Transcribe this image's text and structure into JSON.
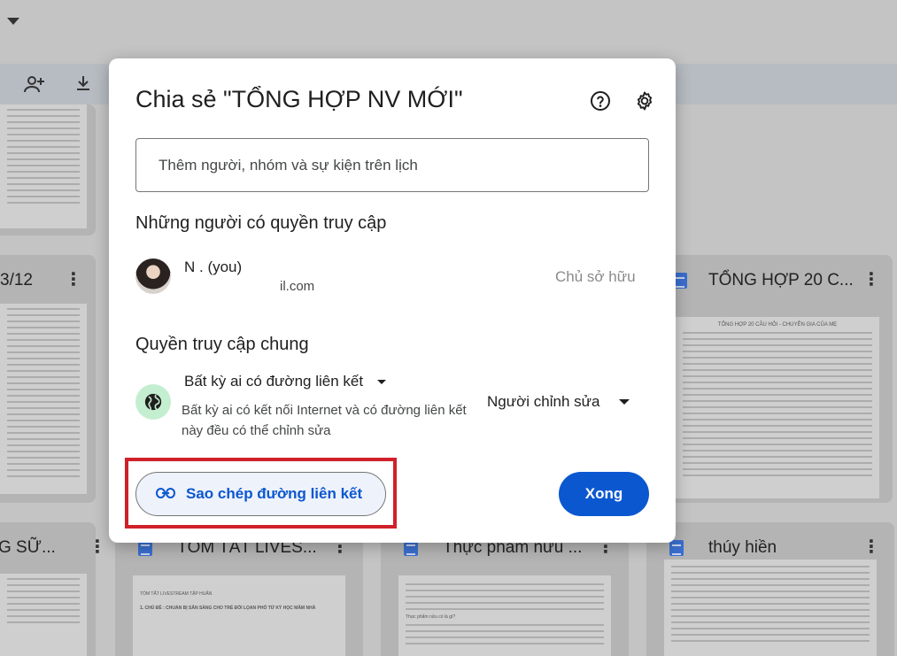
{
  "background": {
    "cards_row2": [
      {
        "title": "3/12"
      },
      {
        "title": "TỔNG HỢP 20 C..."
      }
    ],
    "cards_row3": [
      {
        "title": "G SỮ..."
      },
      {
        "title": "TÓM TẮT LIVES..."
      },
      {
        "title": "Thực phẩm nửu ..."
      },
      {
        "title": "thúy hiền"
      }
    ],
    "thumb_texts": {
      "doc_20_heading": "TỔNG HỢP 20 CÂU HỎI - CHUYÊN GIA CỦA MẸ",
      "doc_tomtat_heading": "TÓM TẮT LIVESTREAM TẬP HUẤN",
      "doc_tomtat_sub": "1. CHỦ ĐỀ : CHUẨN BỊ SẴN SÀNG CHO TRẺ ĐỐI LỌAN PHÓ TỪ KỲ HỌC MẦM NHÀ",
      "doc_thucpham_heading": "Thực phẩm nửu có là gì?"
    }
  },
  "dialog": {
    "title": "Chia sẻ \"TỔNG HỢP NV MỚI\"",
    "add_people_placeholder": "Thêm người, nhóm và sự kiện trên lịch",
    "people_section_title": "Những người có quyền truy cập",
    "user": {
      "name_visible": "N                        . (you)",
      "email_visible": "il.com",
      "role": "Chủ sở hữu"
    },
    "general_section_title": "Quyền truy cập chung",
    "general_access": {
      "option": "Bất kỳ ai có đường liên kết",
      "description": "Bất kỳ ai có kết nối Internet và có đường liên kết này đều có thể chỉnh sửa",
      "role": "Người chỉnh sửa"
    },
    "copy_link_label": "Sao chép đường liên kết",
    "done_label": "Xong"
  },
  "colors": {
    "primary": "#0b57d0",
    "highlight": "#d0202a",
    "globe_bg": "#c4eed0"
  },
  "icons": [
    "help-icon",
    "settings-icon",
    "globe-icon",
    "link-icon",
    "dropdown-caret-icon",
    "add-person-icon",
    "download-icon",
    "more-vert-icon"
  ]
}
